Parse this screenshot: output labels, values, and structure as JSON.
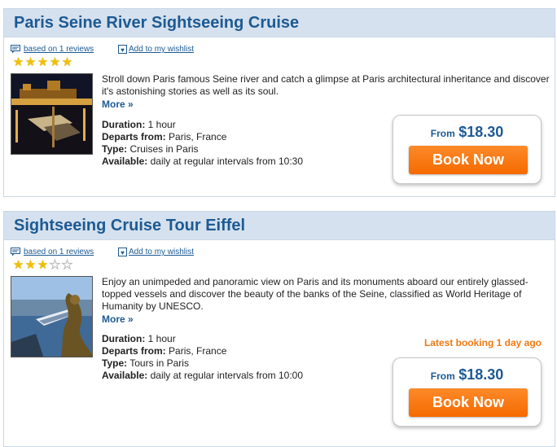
{
  "listings": [
    {
      "title": "Paris Seine River Sightseeing Cruise",
      "reviews_link": "based on 1 reviews",
      "wishlist_link": "Add to my wishlist",
      "rating": 5,
      "max_rating": 5,
      "description": "Stroll down Paris famous Seine river and catch a glimpse at Paris architectural inheritance and discover it's astonishing stories as well as its soul.",
      "more": "More »",
      "duration_label": "Duration:",
      "duration": "1 hour",
      "departs_label": "Departs from:",
      "departs": "Paris, France",
      "type_label": "Type:",
      "type": "Cruises in Paris",
      "available_label": "Available:",
      "available": "daily at regular intervals from 10:30",
      "from_label": "From",
      "price": "$18.30",
      "book_label": "Book Now"
    },
    {
      "title": "Sightseeing Cruise Tour Eiffel",
      "reviews_link": "based on 1 reviews",
      "wishlist_link": "Add to my wishlist",
      "rating": 3,
      "max_rating": 5,
      "description": "Enjoy an unimpeded and panoramic view on Paris and its monuments aboard our entirely glassed-topped vessels and discover the beauty of the banks of the Seine, classified as World Heritage of Humanity by UNESCO.",
      "more": "More »",
      "duration_label": "Duration:",
      "duration": "1 hour",
      "departs_label": "Departs from:",
      "departs": "Paris, France",
      "type_label": "Type:",
      "type": "Tours in Paris",
      "available_label": "Available:",
      "available": "daily at regular intervals from 10:00",
      "latest_booking": "Latest booking 1 day ago",
      "from_label": "From",
      "price": "$18.30",
      "book_label": "Book Now"
    }
  ],
  "colors": {
    "title": "#1d5a93",
    "header_bg": "#d5e1ee",
    "book_button": "#f77a10",
    "star": "#f3c000",
    "latest_booking": "#f07a12"
  }
}
